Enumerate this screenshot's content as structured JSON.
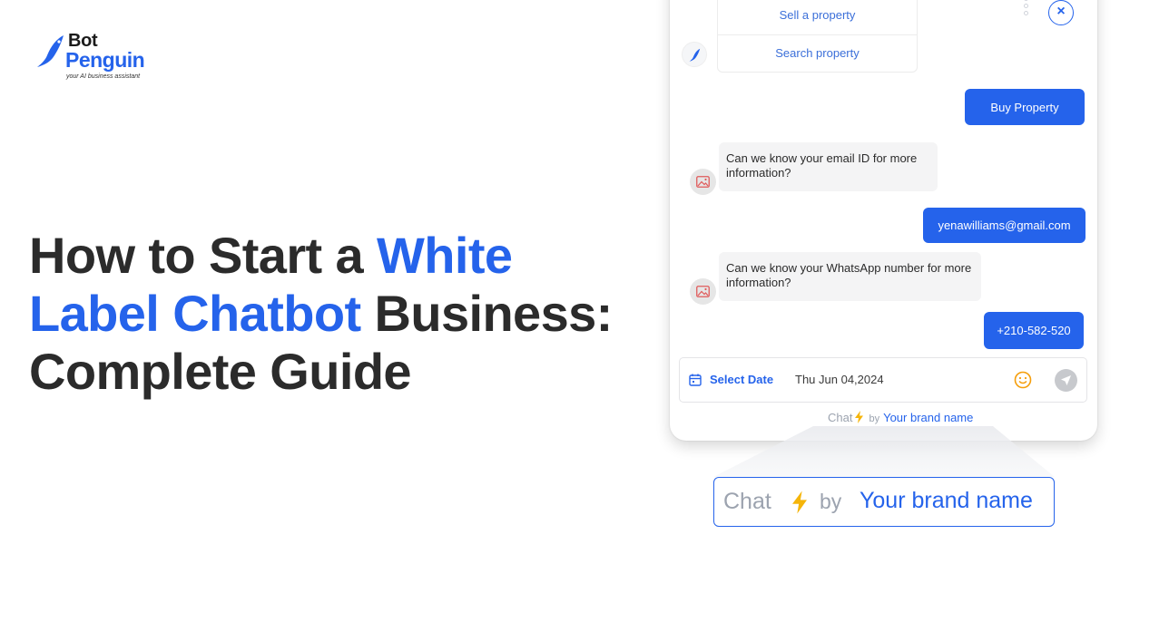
{
  "logo": {
    "line1": "Bot",
    "line2": "Penguin",
    "tagline": "your AI business assistant"
  },
  "headline": {
    "part1": "How to Start a ",
    "highlight1": "White",
    "highlight2": "Label Chatbot",
    "part2": " Business:",
    "part3": "Complete Guide"
  },
  "chat": {
    "options": [
      "Sell a property",
      "Search property"
    ],
    "messages": {
      "buy": "Buy Property",
      "email_question": "Can we know your email ID for more information?",
      "email_answer": "yenawilliams@gmail.com",
      "whatsapp_question": "Can we know your WhatsApp number for more information?",
      "phone_answer": "+210-582-520"
    },
    "input": {
      "select_date": "Select Date",
      "date_value": "Thu Jun 04,2024"
    },
    "powered": {
      "chat": "Chat",
      "by": "by",
      "brand": "Your brand name"
    },
    "close": "×"
  },
  "zoom": {
    "chat": "Chat",
    "by": "by",
    "brand": "Your brand name"
  },
  "colors": {
    "accent": "#2563eb",
    "text": "#2b2b2b",
    "bubble_bot": "#f4f4f5",
    "muted": "#9ca3af",
    "bolt": "#f5b50a"
  },
  "icons": [
    "penguin-logo-icon",
    "bot-avatar-icon",
    "image-placeholder-icon",
    "close-icon",
    "calendar-icon",
    "emoji-icon",
    "send-icon",
    "lightning-icon"
  ]
}
